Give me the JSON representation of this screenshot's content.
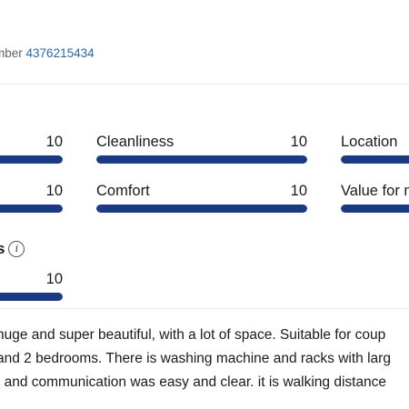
{
  "header": {
    "registration_prefix": "mber",
    "registration_number": "4376215434"
  },
  "scores": {
    "row1": [
      {
        "label": "",
        "value": "10",
        "level": 1.0
      },
      {
        "label": "Cleanliness",
        "value": "10",
        "level": 1.0
      },
      {
        "label": "Location",
        "value": "",
        "level": 1.0
      }
    ],
    "row2": [
      {
        "label": "",
        "value": "10",
        "level": 1.0
      },
      {
        "label": "Comfort",
        "value": "10",
        "level": 1.0
      },
      {
        "label": "Value for m",
        "value": "",
        "level": 1.0
      }
    ]
  },
  "subsection": {
    "title": "s",
    "info_icon": "info-icon",
    "score": {
      "value": "10",
      "level": 1.0
    }
  },
  "review": {
    "lines": [
      "huge and super beautiful, with a lot of space. Suitable for coup",
      "and 2 bedrooms. There is washing machine and racks with larg",
      ", and communication was easy and clear. it is walking distance"
    ]
  },
  "colors": {
    "bar_fill": "#1b3a84",
    "bar_track": "#e3e6ee",
    "link": "#2a66a8"
  }
}
